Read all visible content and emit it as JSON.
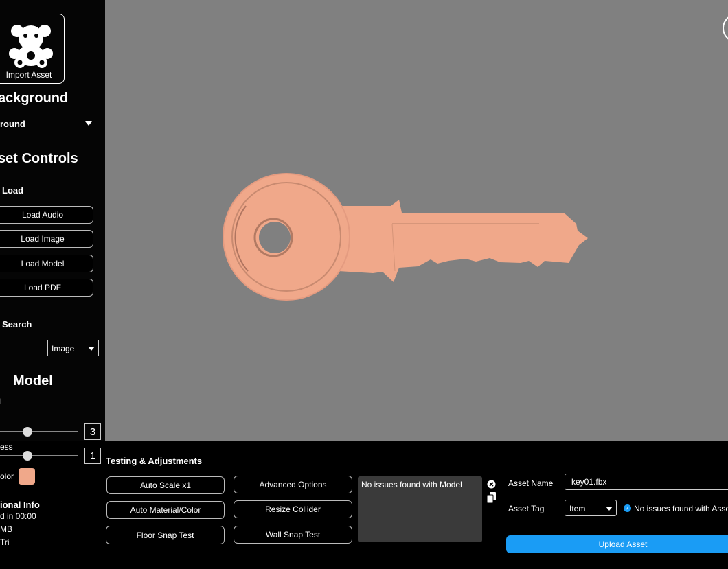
{
  "sidebar": {
    "import_label": "Import Asset",
    "background_title": "ackground",
    "background_select_value": "round",
    "asset_controls_title": "set Controls",
    "load_title": "Load",
    "load_buttons": [
      "Load Audio",
      "Load Image",
      "Load Model",
      "Load PDF"
    ],
    "search_title": "Search",
    "search_type": "Image",
    "model_title": "Model",
    "model_note": "l",
    "slider1_value": "3",
    "slider2_label": "ess",
    "slider2_value": "1",
    "color_label": "olor",
    "model_color": "#f0a88a",
    "info_title": "ional Info",
    "info_lines": [
      "d in 00:00",
      "MB",
      "Tri"
    ]
  },
  "viewport": {
    "background": "#808080",
    "key_color": "#f0a88a"
  },
  "bottom": {
    "section_title": "Testing & Adjustments",
    "col1_buttons": [
      "Auto Scale x1",
      "Auto Material/Color",
      "Floor Snap Test"
    ],
    "col2_buttons": [
      "Advanced Options",
      "Resize Collider",
      "Wall Snap Test"
    ],
    "issues_text": "No issues found with Model",
    "asset_name_label": "Asset Name",
    "asset_name_value": "key01.fbx",
    "asset_tag_label": "Asset Tag",
    "asset_tag_value": "Item",
    "tag_status": "No issues found with Asse",
    "upload_label": "Upload Asset",
    "accent": "#1a9cf5"
  }
}
